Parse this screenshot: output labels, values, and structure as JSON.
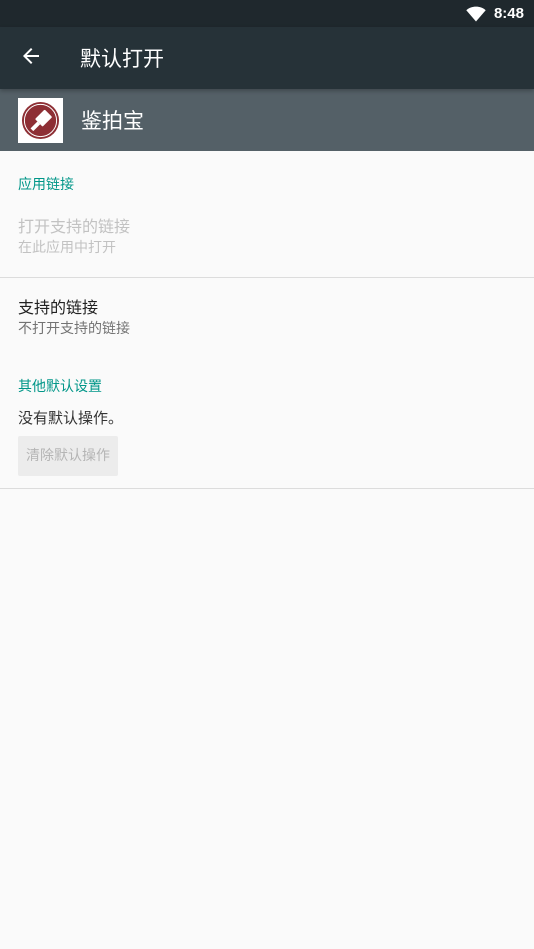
{
  "status_bar": {
    "time": "8:48"
  },
  "toolbar": {
    "title": "默认打开"
  },
  "app": {
    "name": "鉴拍宝"
  },
  "app_links": {
    "header": "应用链接",
    "open_supported": {
      "title": "打开支持的链接",
      "summary": "在此应用中打开"
    },
    "supported_links": {
      "title": "支持的链接",
      "summary": "不打开支持的链接"
    }
  },
  "other_defaults": {
    "header": "其他默认设置",
    "summary": "没有默认操作。",
    "clear_button": "清除默认操作"
  },
  "colors": {
    "status_bar": "#1f282d",
    "toolbar": "#263238",
    "app_header": "#546067",
    "accent": "#009688",
    "app_icon_red": "#8e2f35"
  }
}
